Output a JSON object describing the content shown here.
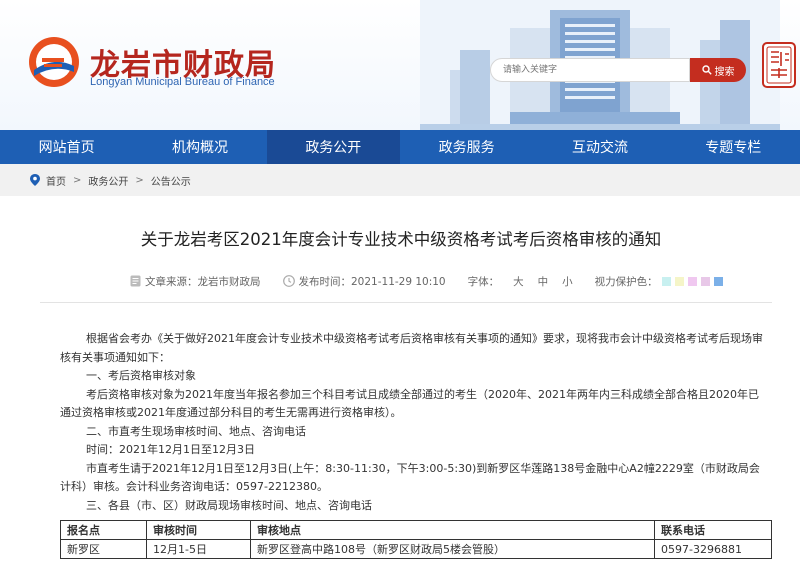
{
  "header": {
    "title": "龙岩市财政局",
    "subtitle": "Longyan Municipal Bureau of Finance",
    "search_placeholder": "请输入关键字",
    "search_button": "搜索",
    "seal_text": "龙岩中国"
  },
  "nav": {
    "items": [
      "网站首页",
      "机构概况",
      "政务公开",
      "政务服务",
      "互动交流",
      "专题专栏"
    ],
    "active_index": 2
  },
  "breadcrumb": {
    "items": [
      "首页",
      "政务公开",
      "公告公示"
    ],
    "separator": ">"
  },
  "article": {
    "title": "关于龙岩考区2021年度会计专业技术中级资格考试考后资格审核的通知",
    "source": "文章来源：龙岩市财政局",
    "publish_time": "发布时间：2021-11-29 10:10",
    "font_label": "字体：",
    "font_sizes": [
      "大",
      "中",
      "小"
    ],
    "vision_label": "视力保护色：",
    "vision_colors": [
      "#c8f0f0",
      "#f5f5c8",
      "#f0c8f0",
      "#e8c8e8",
      "#7bb0e8"
    ],
    "paragraphs": [
      "根据省会考办《关于做好2021年度会计专业技术中级资格考试考后资格审核有关事项的通知》要求，现将我市会计中级资格考试考后现场审核有关事项通知如下：",
      "一、考后资格审核对象",
      "考后资格审核对象为2021年度当年报名参加三个科目考试且成绩全部通过的考生（2020年、2021年两年内三科成绩全部合格且2020年已通过资格审核或2021年度通过部分科目的考生无需再进行资格审核）。",
      "二、市直考生现场审核时间、地点、咨询电话",
      "时间：2021年12月1日至12月3日",
      "市直考生请于2021年12月1日至12月3日(上午：8:30-11:30，下午3:00-5:30)到新罗区华莲路138号金融中心A2幢2229室（市财政局会计科）审核。会计科业务咨询电话：0597-2212380。",
      "三、各县（市、区）财政局现场审核时间、地点、咨询电话"
    ],
    "table": {
      "headers": [
        "报名点",
        "审核时间",
        "审核地点",
        "联系电话"
      ],
      "rows": [
        [
          "新罗区",
          "12月1-5日",
          "新罗区登高中路108号（新罗区财政局5楼会管股）",
          "0597-3296881"
        ]
      ]
    }
  },
  "colors": {
    "nav": "#1e5fb4",
    "nav_active": "#1a4a95",
    "brand_red": "#b5261e",
    "search_btn": "#c42d1f"
  }
}
